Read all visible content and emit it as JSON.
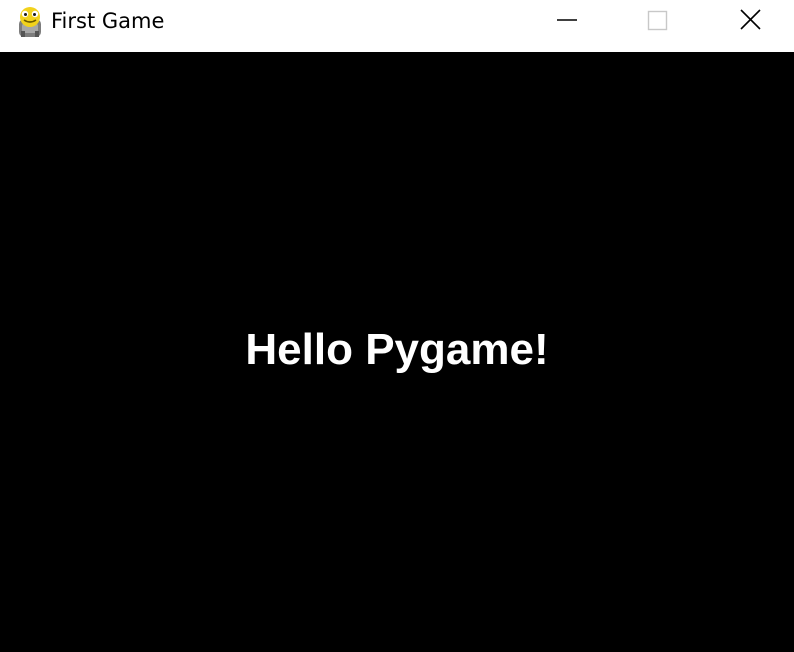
{
  "window": {
    "title": "First Game",
    "icon": "pygame-snake-icon",
    "controls": {
      "minimize": "minimize-icon",
      "maximize": "maximize-icon",
      "close": "close-icon"
    }
  },
  "canvas": {
    "message": "Hello Pygame!",
    "background": "#000000",
    "text_color": "#ffffff"
  }
}
